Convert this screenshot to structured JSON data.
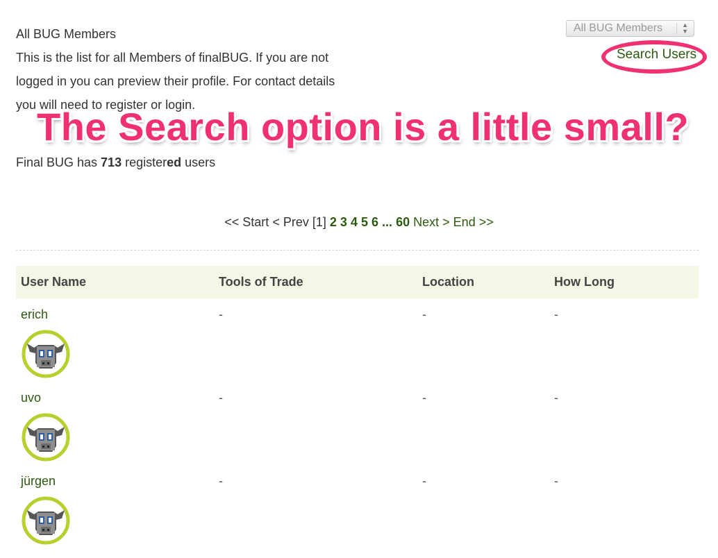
{
  "intro": {
    "heading": "All BUG Members",
    "line1": "This is the list for all Members of finalBUG. If you are not",
    "line2": "logged in you can preview their profile. For contact details",
    "line3": "you will need to register or login."
  },
  "filter": {
    "selected": "All BUG Members"
  },
  "search_link": "Search Users",
  "annotation": "The Search option is a little small?",
  "count": {
    "prefix": "Final BUG has ",
    "number": "713",
    "middle": " register",
    "bold_suffix": "ed",
    "suffix": " users"
  },
  "pagination": {
    "start": "<< Start",
    "prev": "< Prev",
    "current": "[1]",
    "pages": [
      "2",
      "3",
      "4",
      "5",
      "6"
    ],
    "ellipsis": "...",
    "last": "60",
    "next": "Next >",
    "end": "End >>"
  },
  "table": {
    "headers": [
      "User Name",
      "Tools of Trade",
      "Location",
      "How Long"
    ],
    "rows": [
      {
        "name": "erich",
        "tools": "-",
        "location": "-",
        "how_long": "-"
      },
      {
        "name": "uvo",
        "tools": "-",
        "location": "-",
        "how_long": "-"
      },
      {
        "name": "jürgen",
        "tools": "-",
        "location": "-",
        "how_long": "-"
      }
    ]
  },
  "colors": {
    "link": "#2b5a0e",
    "annotation": "#f0316f",
    "header_bg": "#f4f6e6",
    "avatar_ring": "#b8cf2e"
  },
  "icons": {
    "avatar": "bull-avatar-icon",
    "select_arrows": "updown-arrows-icon"
  }
}
